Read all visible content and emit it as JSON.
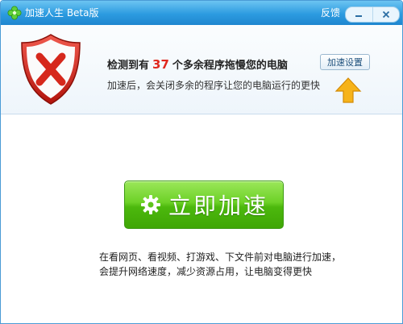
{
  "titlebar": {
    "title": "加速人生 Beta版",
    "feedback": "反馈",
    "icons": {
      "app": "clover-icon",
      "minimize": "minimize-icon",
      "close": "close-icon"
    }
  },
  "header": {
    "detect_prefix": "检测到有",
    "detect_count": "37",
    "detect_suffix": "个多余程序拖慢您的电脑",
    "sub_text": "加速后，会关闭多余的程序让您的电脑运行的更快",
    "settings_label": "加速设置"
  },
  "main": {
    "speed_label": "立即加速",
    "desc_line1": "在看网页、看视频、打游戏、下文件前对电脑进行加速，",
    "desc_line2": "会提升网络速度，减少资源占用，让电脑变得更快"
  },
  "colors": {
    "titlebar": "#2c9be0",
    "accent_red": "#e0281e",
    "button_green": "#4cb80d",
    "arrow_yellow": "#f6b31a"
  }
}
